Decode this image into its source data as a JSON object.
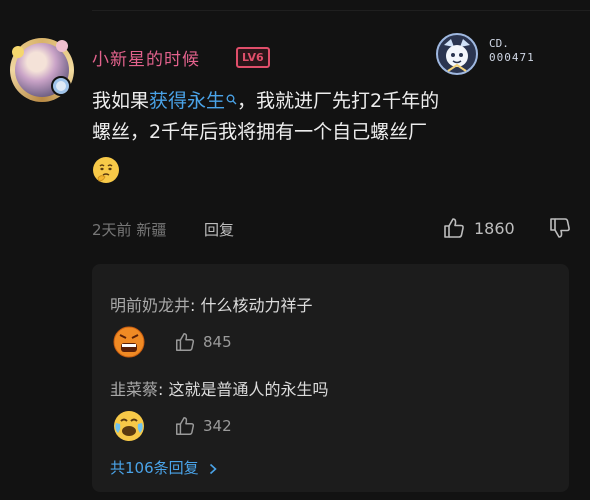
{
  "comment": {
    "username": "小新星的时候",
    "level": "LV6",
    "medal": {
      "label": "CD.",
      "number": "000471"
    },
    "text_parts": {
      "before": "我如果",
      "keyword": "获得永生",
      "after_line1": "，我就进厂先打2千年的",
      "line2": "螺丝，2千年后我将拥有一个自己螺丝厂"
    },
    "time": "2天前",
    "location": "新疆",
    "reply_label": "回复",
    "likes": "1860"
  },
  "replies": [
    {
      "author": "明前奶龙井",
      "text": "什么核动力祥子",
      "likes": "845"
    },
    {
      "author": "韭菜蔡",
      "text": "这就是普通人的永生吗",
      "likes": "342"
    }
  ],
  "more_replies": "共106条回复",
  "icons": {
    "thumb_up": "thumb-up-icon",
    "thumb_down": "thumb-down-icon",
    "search": "search-icon",
    "chevron": "chevron-right-icon"
  },
  "colors": {
    "username": "#e2628c",
    "link": "#4aa3e8",
    "level": "#e04e6a",
    "background": "#121212"
  }
}
